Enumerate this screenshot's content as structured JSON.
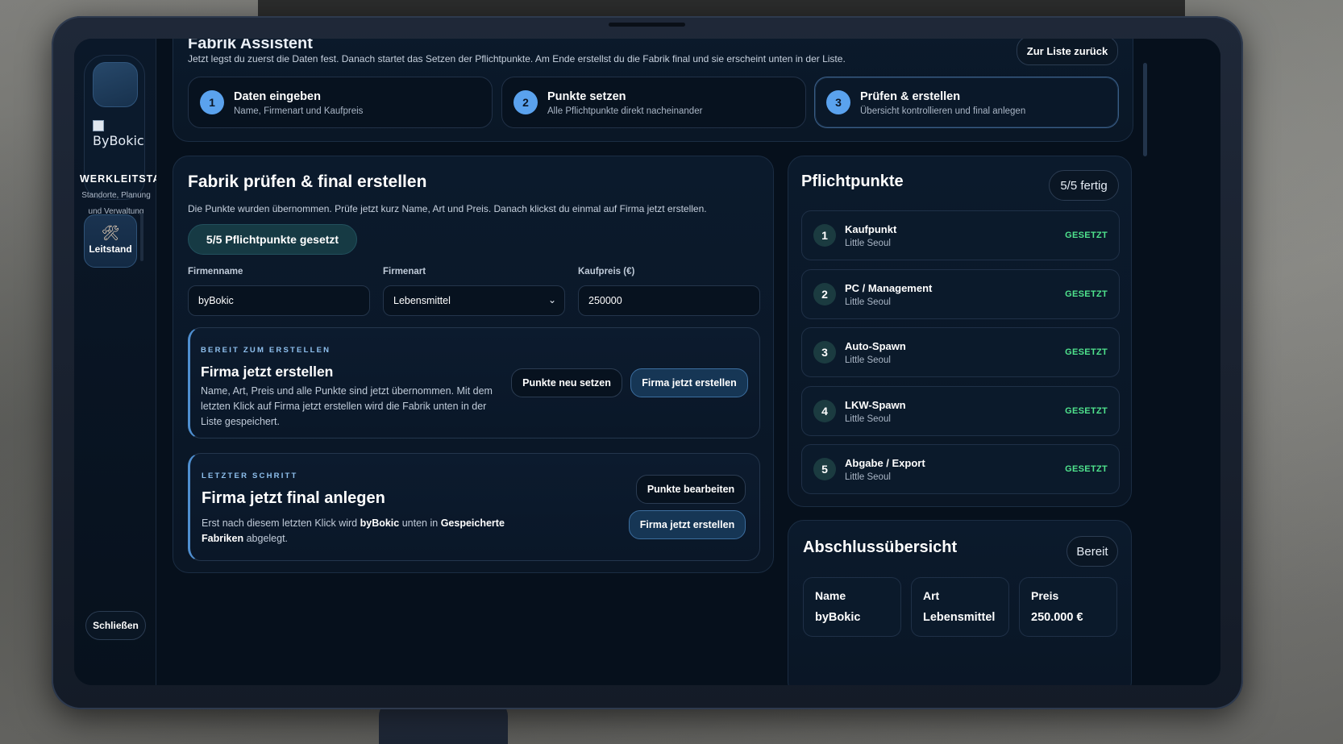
{
  "sidebar": {
    "brand_img_alt": "ByBokic",
    "brand_title": "WERKLEITSTAND",
    "brand_subtitle": "Standorte, Planung und Verwaltung",
    "nav_items": [
      {
        "label": "Leitstand",
        "icon": "tools-icon"
      }
    ],
    "close_label": "Schließen"
  },
  "header": {
    "title": "Fabrik Assistent",
    "intro": "Jetzt legst du zuerst die Daten fest. Danach startet das Setzen der Pflichtpunkte. Am Ende erstellst du die Fabrik final und sie erscheint unten in der Liste.",
    "back_label": "Zur Liste zurück"
  },
  "steps": [
    {
      "num": "1",
      "title": "Daten eingeben",
      "sub": "Name, Firmenart und Kaufpreis"
    },
    {
      "num": "2",
      "title": "Punkte setzen",
      "sub": "Alle Pflichtpunkte direkt nacheinander"
    },
    {
      "num": "3",
      "title": "Prüfen & erstellen",
      "sub": "Übersicht kontrollieren und final anlegen"
    }
  ],
  "review": {
    "title": "Fabrik prüfen & final erstellen",
    "intro": "Die Punkte wurden übernommen. Prüfe jetzt kurz Name, Art und Preis. Danach klickst du einmal auf Firma jetzt erstellen.",
    "count_pill": "5/5 Pflichtpunkte gesetzt",
    "fields": {
      "name_label": "Firmenname",
      "name_value": "byBokic",
      "type_label": "Firmenart",
      "type_value": "Lebensmittel",
      "price_label": "Kaufpreis (€)",
      "price_value": "250000"
    },
    "create_box": {
      "eyebrow": "BEREIT ZUM ERSTELLEN",
      "title": "Firma jetzt erstellen",
      "text": "Name, Art, Preis und alle Punkte sind jetzt übernommen. Mit dem letzten Klick auf Firma jetzt erstellen wird die Fabrik unten in der Liste gespeichert.",
      "reset_label": "Punkte neu setzen",
      "create_label": "Firma jetzt erstellen"
    },
    "final_box": {
      "eyebrow": "LETZTER SCHRITT",
      "title": "Firma jetzt final anlegen",
      "text_a": "Erst nach diesem letzten Klick wird ",
      "text_b": "byBokic",
      "text_c": " unten in ",
      "text_d": "Gespeicherte Fabriken",
      "text_e": " abgelegt.",
      "edit_label": "Punkte bearbeiten",
      "create_label": "Firma jetzt erstellen"
    }
  },
  "points": {
    "title": "Pflichtpunkte",
    "badge": "5/5 fertig",
    "items": [
      {
        "num": "1",
        "title": "Kaufpunkt",
        "place": "Little Seoul",
        "status": "GESETZT"
      },
      {
        "num": "2",
        "title": "PC / Management",
        "place": "Little Seoul",
        "status": "GESETZT"
      },
      {
        "num": "3",
        "title": "Auto-Spawn",
        "place": "Little Seoul",
        "status": "GESETZT"
      },
      {
        "num": "4",
        "title": "LKW-Spawn",
        "place": "Little Seoul",
        "status": "GESETZT"
      },
      {
        "num": "5",
        "title": "Abgabe / Export",
        "place": "Little Seoul",
        "status": "GESETZT"
      }
    ],
    "status_color": "#4fe38d"
  },
  "summary": {
    "title": "Abschlussübersicht",
    "badge": "Bereit",
    "cells": [
      {
        "key": "Name",
        "value": "byBokic"
      },
      {
        "key": "Art",
        "value": "Lebensmittel"
      },
      {
        "key": "Preis",
        "value": "250.000 €"
      }
    ]
  },
  "colors": {
    "accent": "#5aa2ee",
    "panel": "#0b1a2c",
    "background": "#06101c"
  }
}
